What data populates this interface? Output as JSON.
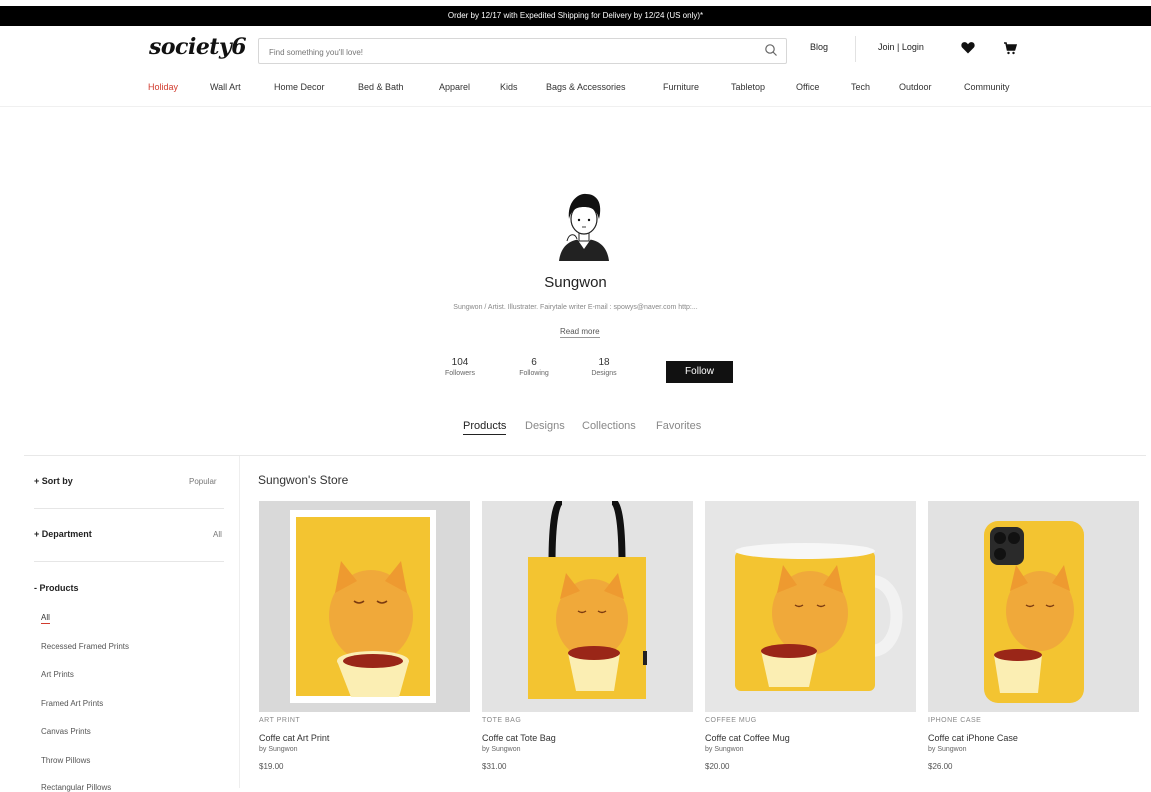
{
  "promo": {
    "text": "Order by 12/17 with Expedited Shipping for Delivery by 12/24 (US only)*"
  },
  "header": {
    "logo": "society6",
    "search_placeholder": "Find something you'll love!",
    "blog": "Blog",
    "join": "Join | Login"
  },
  "nav": [
    "Holiday",
    "Wall Art",
    "Home Decor",
    "Bed & Bath",
    "Apparel",
    "Kids",
    "Bags & Accessories",
    "Furniture",
    "Tabletop",
    "Office",
    "Tech",
    "Outdoor",
    "Community"
  ],
  "profile": {
    "name": "Sungwon",
    "bio": "Sungwon / Artist. Illustrater. Fairytale writer E-mail : spowys@naver.com http:...",
    "read_more": "Read more",
    "followers_count": "104",
    "followers_label": "Followers",
    "following_count": "6",
    "following_label": "Following",
    "designs_count": "18",
    "designs_label": "Designs",
    "follow_button": "Follow"
  },
  "profile_tabs": [
    "Products",
    "Designs",
    "Collections",
    "Favorites"
  ],
  "filters": {
    "sort_label": "+ Sort by",
    "sort_value": "Popular",
    "dept_label": "+ Department",
    "dept_value": "All",
    "products_label": "- Products",
    "product_items": [
      "All",
      "Recessed Framed Prints",
      "Art Prints",
      "Framed Art Prints",
      "Canvas Prints",
      "Throw Pillows",
      "Rectangular Pillows"
    ]
  },
  "store": {
    "title": "Sungwon's Store",
    "products": [
      {
        "type": "ART PRINT",
        "title": "Coffe cat Art Print",
        "by": "by Sungwon",
        "price": "$19.00"
      },
      {
        "type": "TOTE BAG",
        "title": "Coffe cat Tote Bag",
        "by": "by Sungwon",
        "price": "$31.00"
      },
      {
        "type": "COFFEE MUG",
        "title": "Coffe cat Coffee Mug",
        "by": "by Sungwon",
        "price": "$20.00"
      },
      {
        "type": "IPHONE CASE",
        "title": "Coffe cat iPhone Case",
        "by": "by Sungwon",
        "price": "$26.00"
      }
    ]
  },
  "colors": {
    "accent": "#d13b2e",
    "art_yellow": "#f3c431",
    "black": "#111111"
  }
}
